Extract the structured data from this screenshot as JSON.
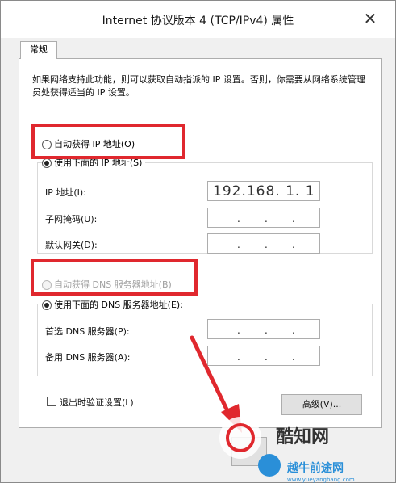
{
  "window": {
    "title": "Internet 协议版本 4 (TCP/IPv4) 属性",
    "close_glyph": "✕"
  },
  "tabs": [
    {
      "label": "常规"
    }
  ],
  "description": "如果网络支持此功能，则可以获取自动指派的 IP 设置。否则，你需要从网络系统管理员处获得适当的 IP 设置。",
  "ip_mode": {
    "auto_label": "自动获得 IP 地址(O)",
    "manual_label": "使用下面的 IP 地址(S)",
    "selected": "manual"
  },
  "ip_fields": {
    "ip_label": "IP 地址(I):",
    "ip_value": "192.168.  1.  1",
    "mask_label": "子网掩码(U):",
    "gateway_label": "默认网关(D):"
  },
  "dns_mode": {
    "auto_label": "自动获得 DNS 服务器地址(B)",
    "manual_label": "使用下面的 DNS 服务器地址(E):",
    "selected": "manual",
    "auto_disabled": true
  },
  "dns_fields": {
    "preferred_label": "首选 DNS 服务器(P):",
    "alternate_label": "备用 DNS 服务器(A):"
  },
  "validate_on_exit": {
    "label": "退出时验证设置(L)",
    "checked": false
  },
  "advanced_button": "高级(V)...",
  "highlight_color": "#e0282e",
  "watermark": {
    "text1": "酷知网",
    "text2": "越牛前途网",
    "text3": "www.yueyangbang.com"
  }
}
